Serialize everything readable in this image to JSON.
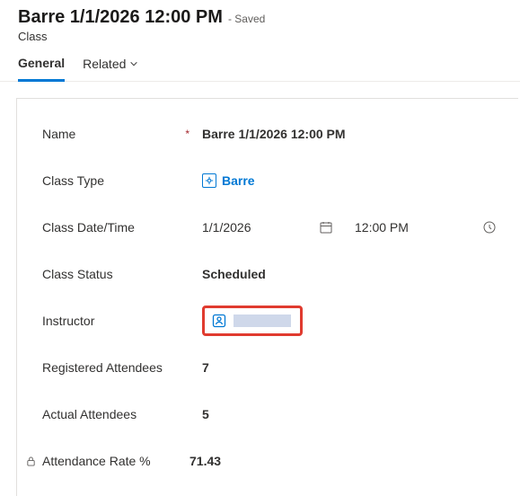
{
  "header": {
    "title": "Barre 1/1/2026 12:00 PM",
    "saved_suffix": "- Saved",
    "entity": "Class"
  },
  "tabs": {
    "general": "General",
    "related": "Related"
  },
  "fields": {
    "name": {
      "label": "Name",
      "value": "Barre 1/1/2026 12:00 PM"
    },
    "class_type": {
      "label": "Class Type",
      "value": "Barre"
    },
    "class_datetime": {
      "label": "Class Date/Time",
      "date": "1/1/2026",
      "time": "12:00 PM"
    },
    "class_status": {
      "label": "Class Status",
      "value": "Scheduled"
    },
    "instructor": {
      "label": "Instructor"
    },
    "registered": {
      "label": "Registered Attendees",
      "value": "7"
    },
    "actual": {
      "label": "Actual Attendees",
      "value": "5"
    },
    "rate": {
      "label": "Attendance Rate %",
      "value": "71.43"
    }
  }
}
